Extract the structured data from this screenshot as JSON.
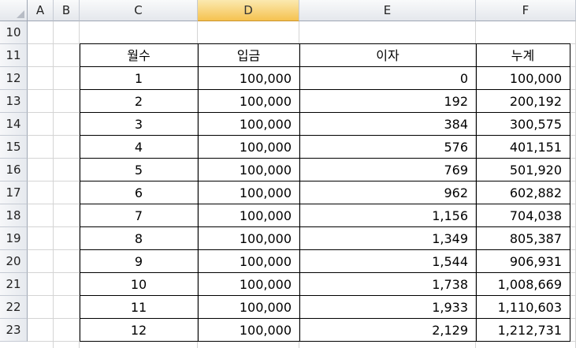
{
  "columns": [
    "A",
    "B",
    "C",
    "D",
    "E",
    "F"
  ],
  "selected_column": "D",
  "rows": [
    "10",
    "11",
    "12",
    "13",
    "14",
    "15",
    "16",
    "17",
    "18",
    "19",
    "20",
    "21",
    "22",
    "23"
  ],
  "table": {
    "headers": [
      "월수",
      "입금",
      "이자",
      "누계"
    ],
    "data": [
      [
        "1",
        "100,000",
        "0",
        "100,000"
      ],
      [
        "2",
        "100,000",
        "192",
        "200,192"
      ],
      [
        "3",
        "100,000",
        "384",
        "300,575"
      ],
      [
        "4",
        "100,000",
        "576",
        "401,151"
      ],
      [
        "5",
        "100,000",
        "769",
        "501,920"
      ],
      [
        "6",
        "100,000",
        "962",
        "602,882"
      ],
      [
        "7",
        "100,000",
        "1,156",
        "704,038"
      ],
      [
        "8",
        "100,000",
        "1,349",
        "805,387"
      ],
      [
        "9",
        "100,000",
        "1,544",
        "906,931"
      ],
      [
        "10",
        "100,000",
        "1,738",
        "1,008,669"
      ],
      [
        "11",
        "100,000",
        "1,933",
        "1,110,603"
      ],
      [
        "12",
        "100,000",
        "2,129",
        "1,212,731"
      ]
    ]
  }
}
